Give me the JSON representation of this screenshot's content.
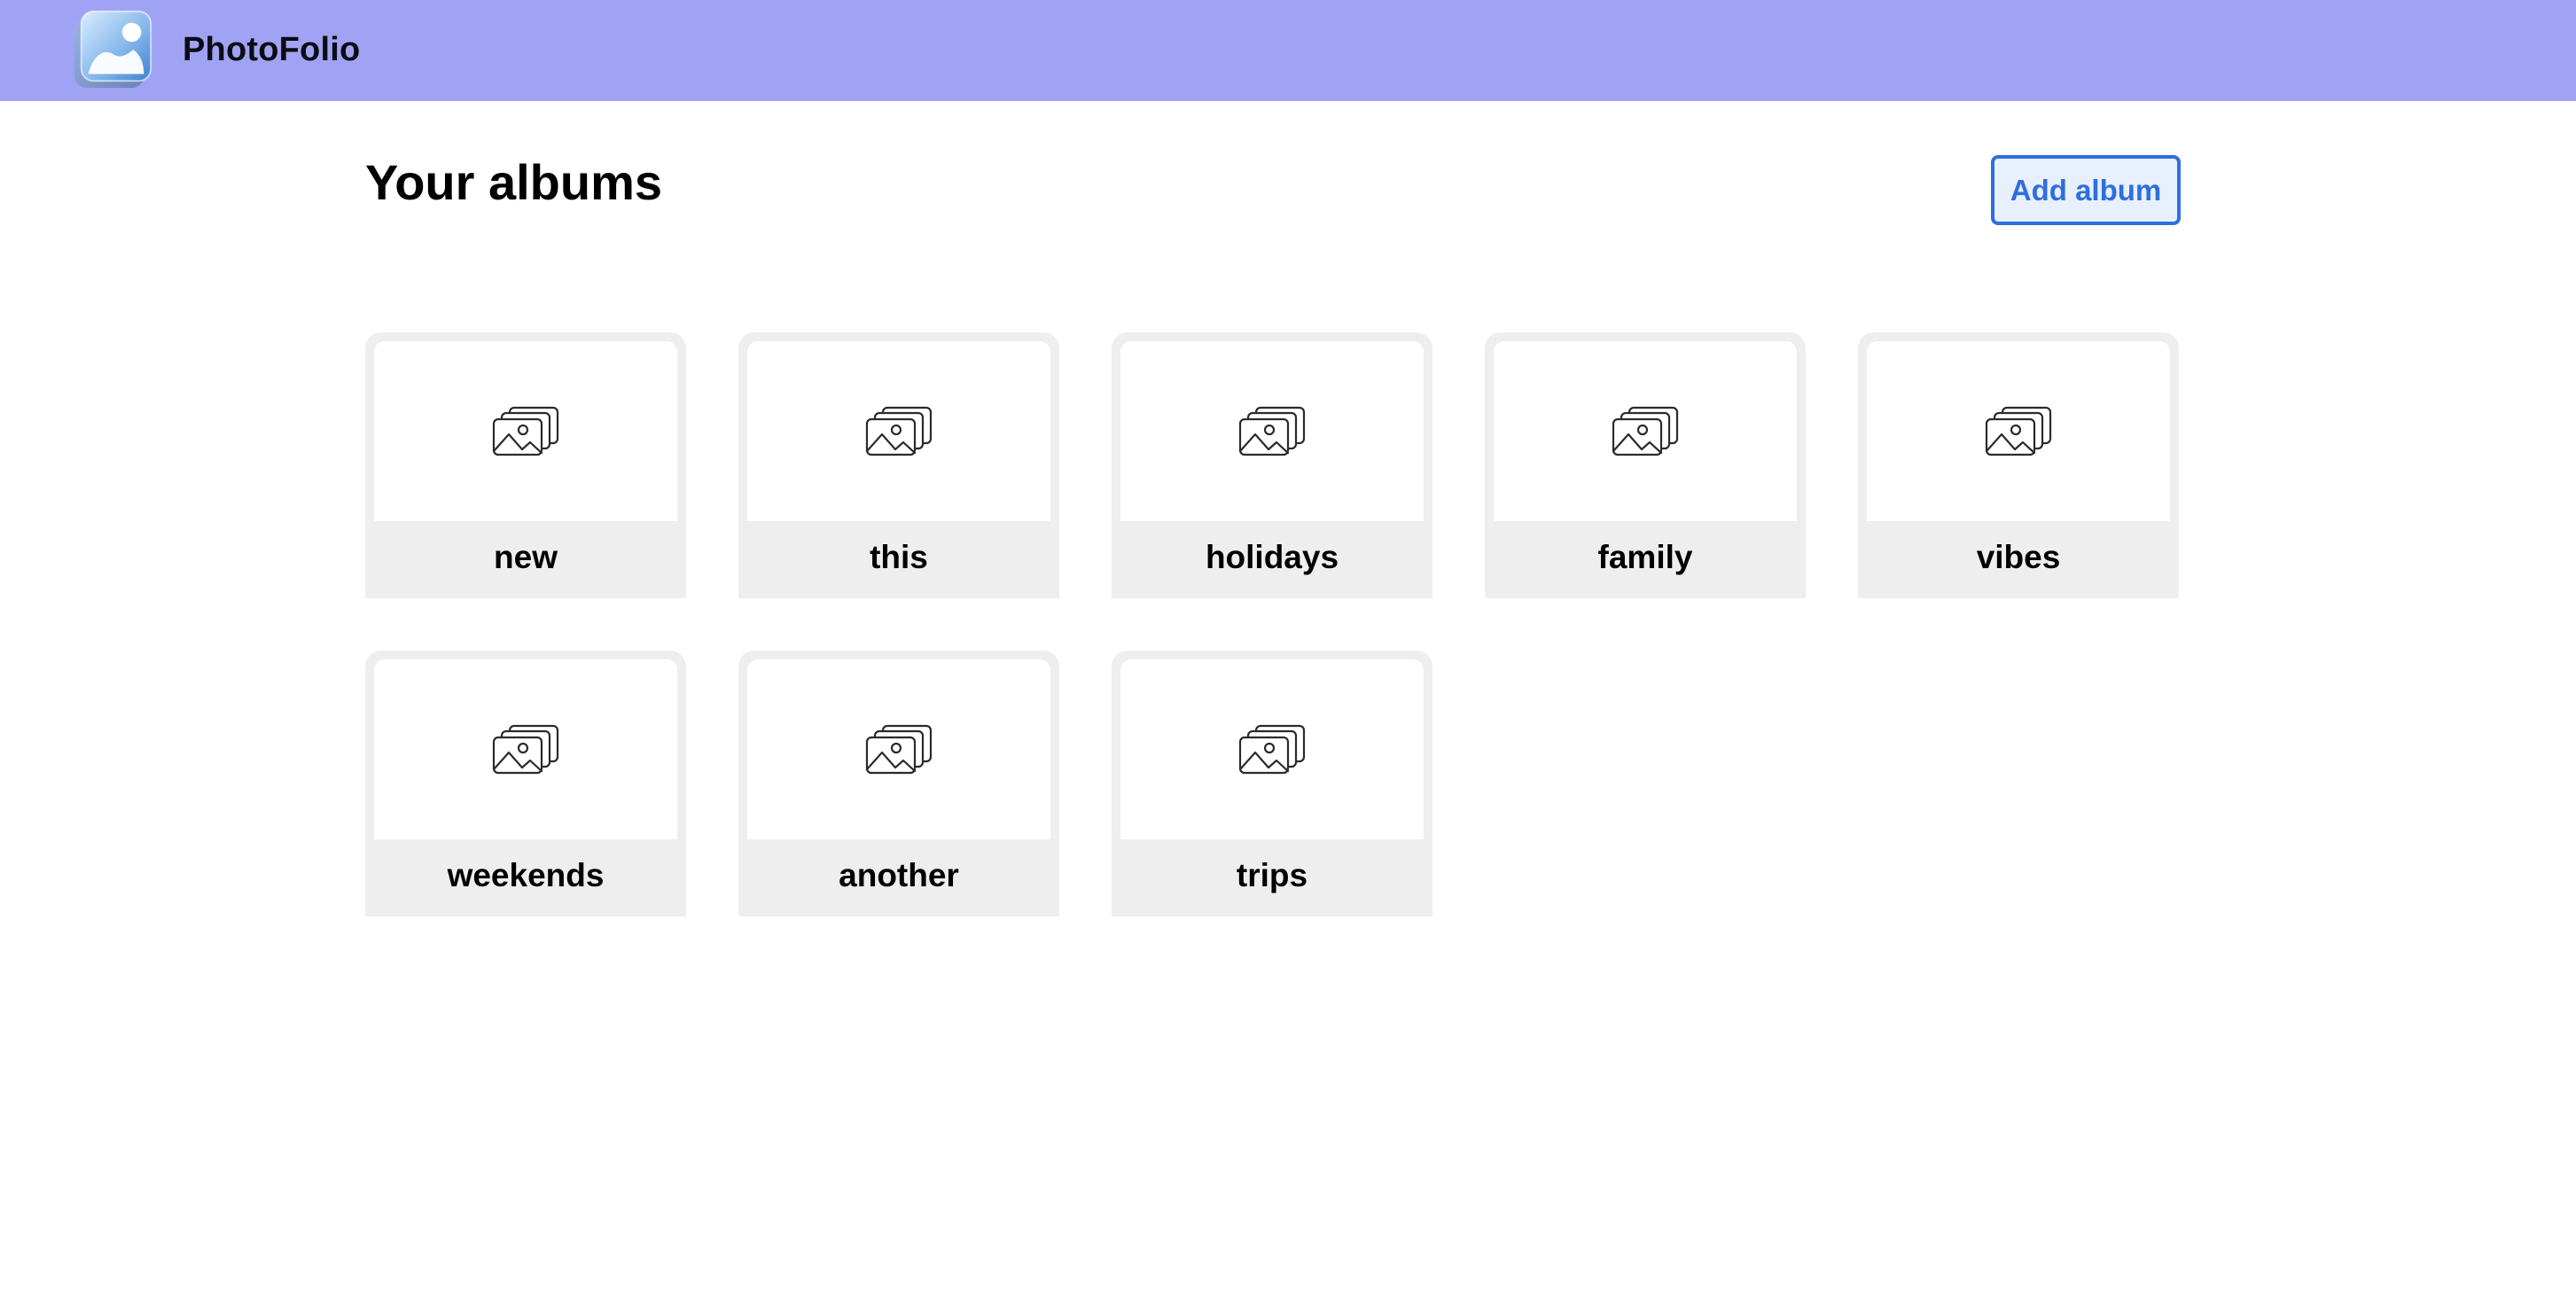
{
  "app": {
    "name": "PhotoFolio",
    "logo_icon": "photo-stack-icon",
    "nav_color": "#a0a2f3"
  },
  "page": {
    "heading": "Your albums",
    "add_button_label": "Add album",
    "accent_color": "#2f6fdc"
  },
  "albums": [
    {
      "name": "new",
      "icon": "images-icon"
    },
    {
      "name": "this",
      "icon": "images-icon"
    },
    {
      "name": "holidays",
      "icon": "images-icon"
    },
    {
      "name": "family",
      "icon": "images-icon"
    },
    {
      "name": "vibes",
      "icon": "images-icon"
    },
    {
      "name": "weekends",
      "icon": "images-icon"
    },
    {
      "name": "another",
      "icon": "images-icon"
    },
    {
      "name": "trips",
      "icon": "images-icon"
    }
  ]
}
